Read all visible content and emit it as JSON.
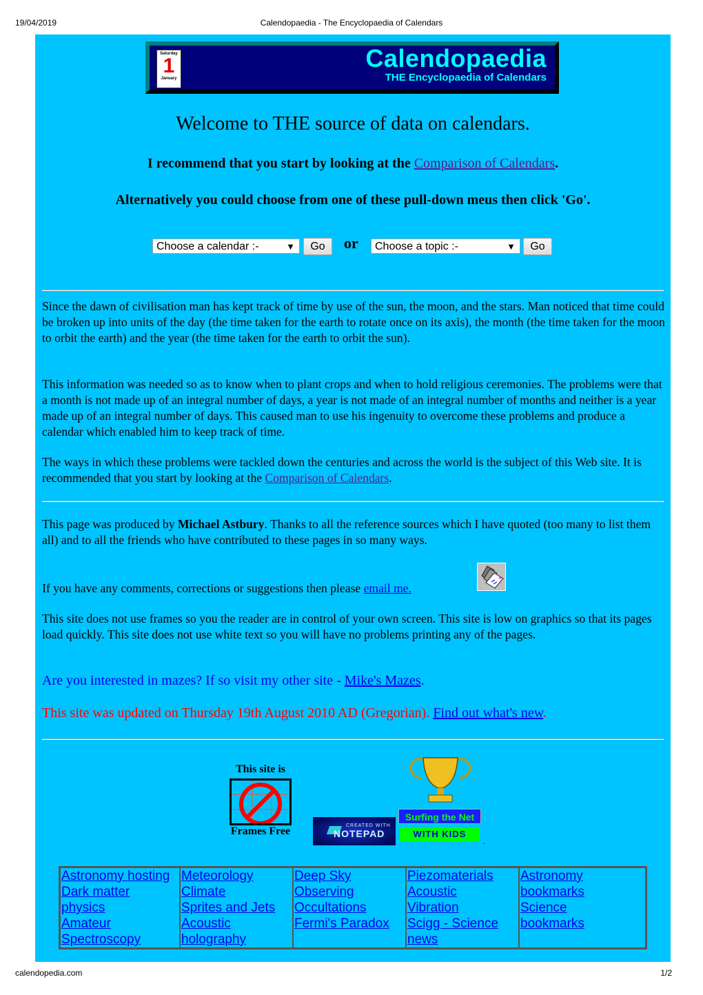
{
  "print_header": {
    "date": "19/04/2019",
    "title": "Calendopaedia - The Encyclopaedia of Calendars"
  },
  "print_footer": {
    "url": "calendopedia.com",
    "page": "1/2"
  },
  "banner": {
    "calendar_icon": {
      "day": "Saturday",
      "number": "1",
      "month": "January"
    },
    "brand": "Calendopaedia",
    "tagline": "THE Encyclopaedia of Calendars"
  },
  "welcome": "Welcome to THE source of data on calendars.",
  "recommend": {
    "prefix": "I recommend that you start by looking at the ",
    "link": "Comparison of Calendars",
    "suffix": "."
  },
  "alternative": "Alternatively you could choose from one of these pull-down meus then click 'Go'.",
  "controls": {
    "calendar_select": "Choose a calendar :-",
    "go_label": "Go",
    "or_label": "or",
    "topic_select": "Choose a topic :-",
    "go2_label": "Go"
  },
  "intro": {
    "p1": "Since the dawn of civilisation man has kept track of time by use of the sun, the moon, and the stars. Man noticed that time could be broken up into units of the day (the time taken for the earth to rotate once on its axis), the month (the time taken for the moon to orbit the earth) and the year (the time taken for the earth to orbit the sun).",
    "p2": "This information was needed so as to know when to plant crops and when to hold religious ceremonies. The problems were that a month is not made up of an integral number of days, a year is not made of an integral number of months and neither is a year made up of an integral number of days. This caused man to use his ingenuity to overcome these problems and produce a calendar which enabled him to keep track of time.",
    "p3_prefix": "The ways in which these problems were tackled down the centuries and across the world is the subject of this Web site. It is recommended that you start by looking at the ",
    "p3_link": "Comparison of Calendars",
    "p3_suffix": "."
  },
  "credits": {
    "prefix": "This page was produced by ",
    "author": "Michael Astbury",
    "suffix": ". Thanks to all the reference sources which I have quoted (too many to list them all) and to all the friends who have contributed to these pages in so many ways.",
    "contact_prefix": "If you have any comments, corrections or suggestions then please ",
    "contact_link": "email me. ",
    "frames_note": "This site does not use frames so you the reader are in control of your own screen. This site is low on graphics so that its pages load quickly. This site does not use white text so you will have no problems printing any of the pages.",
    "mazes_prefix": "Are you interested in mazes? If so visit my other site - ",
    "mazes_link": "Mike's Mazes",
    "mazes_suffix": ".",
    "updated_prefix": "This site was updated on Thursday 19th August 2010 AD (Gregorian). ",
    "updated_link": "Find out what's new",
    "updated_suffix": "."
  },
  "badges": {
    "frames_top": "This site is",
    "frames_bottom": "Frames Free",
    "notepad_small": "CREATED WITH",
    "notepad_big": "NOTEPAD",
    "kids_top": "Surfing the Net",
    "kids_bottom": "WITH KIDS",
    "dot": "."
  },
  "link_table": {
    "columns": [
      [
        "Astronomy hosting",
        "Dark matter",
        "physics",
        "Amateur",
        "Spectroscopy"
      ],
      [
        "Meteorology",
        "Climate",
        "Sprites and Jets",
        "Acoustic",
        "holography"
      ],
      [
        "Deep Sky",
        "Observing",
        "Occultations",
        "Fermi's Paradox"
      ],
      [
        "Piezomaterials",
        "Acoustic",
        "Vibration",
        "Scigg - Science",
        "news"
      ],
      [
        "Astronomy",
        "bookmarks",
        "Science",
        "bookmarks"
      ]
    ]
  },
  "colors": {
    "page_background": "#00c4ff",
    "banner_background": "#00007a",
    "brand_text": "#00ffff",
    "link": "#0000ee",
    "visited_link": "#551a8b",
    "update_text": "#ff0000"
  }
}
